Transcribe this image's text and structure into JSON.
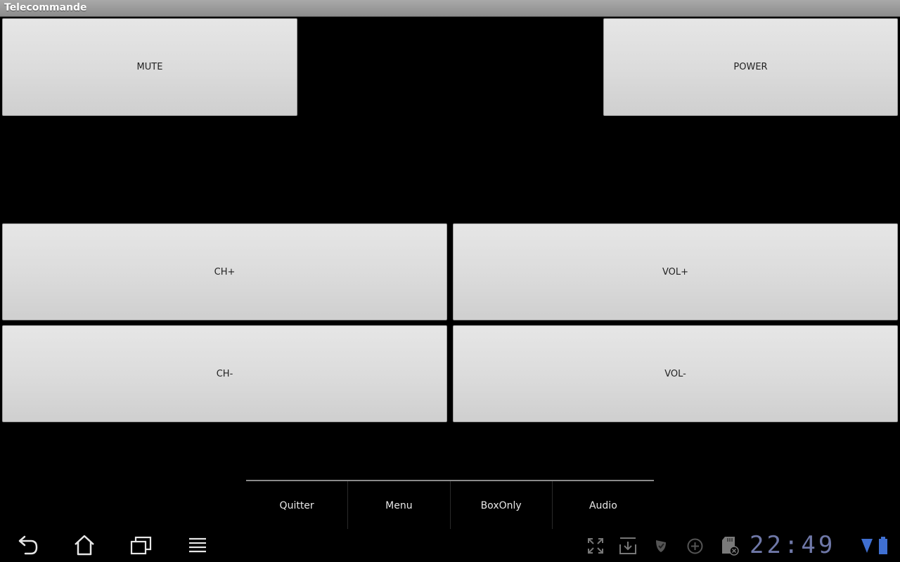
{
  "window": {
    "title": "Telecommande"
  },
  "buttons": {
    "mute": "MUTE",
    "power": "POWER",
    "ch_up": "CH+",
    "vol_up": "VOL+",
    "ch_down": "CH-",
    "vol_down": "VOL-"
  },
  "menu": {
    "items": [
      {
        "label": "Quitter"
      },
      {
        "label": "Menu"
      },
      {
        "label": "BoxOnly"
      },
      {
        "label": "Audio"
      }
    ]
  },
  "system_bar": {
    "clock": "22:49",
    "nav_icons": [
      "back-icon",
      "home-icon",
      "recent-apps-icon",
      "menu-icon"
    ],
    "status_icons": [
      "fullscreen-icon",
      "download-icon",
      "shield-icon",
      "add-circle-icon",
      "sd-card-error-icon",
      "wifi-icon",
      "battery-icon"
    ],
    "accent_color": "#6f78a8"
  }
}
